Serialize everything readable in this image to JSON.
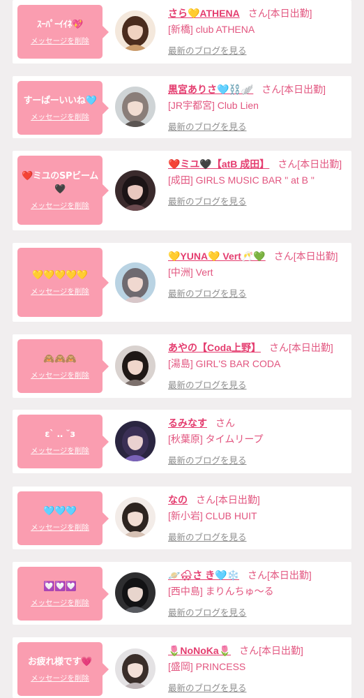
{
  "list": {
    "items": [
      {
        "message": "ｽｰﾊﾟｰｲｲﾈ💖",
        "delete_label": "メッセージを削除",
        "name": "さら💛ATHENA",
        "suffix": "さん[本日出勤]",
        "shop": "[新橋] club ATHENA",
        "blog_link": "最新のブログを見る",
        "avatar_colors": [
          "#f4e8dc",
          "#4a2c1e",
          "#f0d2c0",
          "#c99a6a"
        ]
      },
      {
        "message": "すーぱーいいね🩵",
        "delete_label": "メッセージを削除",
        "name": "黒宮ありさ🩵⛓️🪽",
        "suffix": "さん[本日出勤]",
        "shop": "[JR宇都宮] Club Lien",
        "blog_link": "最新のブログを見る",
        "avatar_colors": [
          "#cfd4d6",
          "#8a7e79",
          "#f1ddd2",
          "#5b5552"
        ]
      },
      {
        "message": "❤️ミユのSPビーム🖤",
        "delete_label": "メッセージを削除",
        "name": "❤️ミユ🖤【atB 成田】",
        "suffix": "さん[本日出勤]",
        "shop": "[成田] GIRLS MUSIC BAR \" at B \"",
        "blog_link": "最新のブログを見る",
        "avatar_colors": [
          "#3a2a2c",
          "#1c1416",
          "#e9c8bf",
          "#6b4a4e"
        ]
      },
      {
        "message": "💛💛💛💛💛",
        "delete_label": "メッセージを削除",
        "name": "💛YUNA💛 Vert🥂💚",
        "suffix": "さん[本日出勤]",
        "shop": "[中洲] Vert",
        "blog_link": "最新のブログを見る",
        "avatar_colors": [
          "#b9d3e3",
          "#6f6a70",
          "#f0d8d0",
          "#d8c7c9"
        ]
      },
      {
        "message": "🙈🙈🙈",
        "delete_label": "メッセージを削除",
        "name": "あやの【Coda上野】",
        "suffix": "さん[本日出勤]",
        "shop": "[湯島] GIRL'S BAR CODA",
        "blog_link": "最新のブログを見る",
        "avatar_colors": [
          "#d9d2cf",
          "#1f1816",
          "#efd6cb",
          "#7c706c"
        ]
      },
      {
        "message": "ε` ‥ ˘з",
        "delete_label": "メッセージを削除",
        "name": "るみなす",
        "suffix": "さん",
        "shop": "[秋葉原] タイムリープ",
        "blog_link": "最新のブログを見る",
        "avatar_colors": [
          "#2a2540",
          "#3a2f55",
          "#ead1d0",
          "#7a62b8"
        ]
      },
      {
        "message": "🩵🩵🩵",
        "delete_label": "メッセージを削除",
        "name": "なの",
        "suffix": "さん[本日出勤]",
        "shop": "[新小岩] CLUB HUIT",
        "blog_link": "最新のブログを見る",
        "avatar_colors": [
          "#f3ece8",
          "#2d2420",
          "#f2ddd3",
          "#d6c1b4"
        ]
      },
      {
        "message": "💟💟💟",
        "delete_label": "メッセージを削除",
        "name": "🪐🌨さ き🩵❄️",
        "suffix": "さん[本日出勤]",
        "shop": "[西中島] まりんちゅ〜る",
        "blog_link": "最新のブログを見る",
        "avatar_colors": [
          "#2e2e30",
          "#121214",
          "#e8d5cd",
          "#585a60"
        ]
      },
      {
        "message": "お疲れ様です💗",
        "delete_label": "メッセージを削除",
        "name": "🌷NoNoKa🌷",
        "suffix": "さん[本日出勤]",
        "shop": "[盛岡] PRINCESS",
        "blog_link": "最新のブログを見る",
        "avatar_colors": [
          "#e4e2e4",
          "#3a2e2a",
          "#f3e0d8",
          "#bfb6b8"
        ]
      }
    ]
  }
}
